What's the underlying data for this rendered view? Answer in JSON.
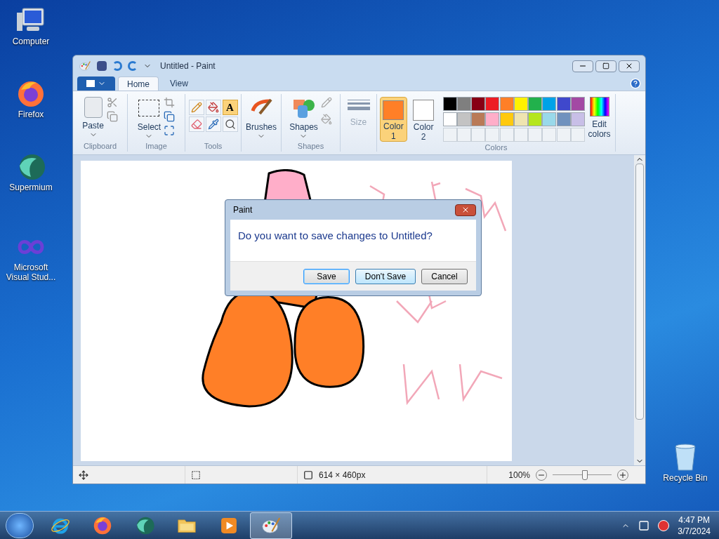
{
  "desktop_icons": [
    {
      "kind": "computer",
      "label": "Computer"
    },
    {
      "kind": "firefox",
      "label": "Firefox"
    },
    {
      "kind": "supermium",
      "label": "Supermium"
    },
    {
      "kind": "vs",
      "label": "Microsoft Visual Stud..."
    },
    {
      "kind": "recycle",
      "label": "Recycle Bin"
    }
  ],
  "window": {
    "title": "Untitled - Paint",
    "tabs": [
      {
        "label": "Home",
        "selected": true
      },
      {
        "label": "View",
        "selected": false
      }
    ],
    "ribbon": {
      "clipboard": {
        "label": "Clipboard",
        "paste": "Paste"
      },
      "image": {
        "label": "Image",
        "select": "Select"
      },
      "tools": {
        "label": "Tools",
        "items": [
          {
            "kind": "pencil",
            "selected": false
          },
          {
            "kind": "fill",
            "selected": false
          },
          {
            "kind": "text",
            "glyph": "A",
            "selected": true
          },
          {
            "kind": "eraser",
            "selected": false
          },
          {
            "kind": "picker",
            "selected": false
          },
          {
            "kind": "magnifier",
            "selected": false
          }
        ]
      },
      "brushes": "Brushes",
      "shapes": {
        "label": "Shapes",
        "button": "Shapes"
      },
      "size": {
        "label": "Size",
        "disabled": true
      },
      "colors": {
        "label": "Colors",
        "edit": "Edit colors",
        "current": [
          {
            "label": "Color 1",
            "color": "#ff7f27",
            "selected": true
          },
          {
            "label": "Color 2",
            "color": "#ffffff",
            "selected": false
          }
        ],
        "palette": [
          {
            "color": "#000000"
          },
          {
            "color": "#7f7f7f"
          },
          {
            "color": "#880015"
          },
          {
            "color": "#ed1c24"
          },
          {
            "color": "#ff7f27"
          },
          {
            "color": "#fff200"
          },
          {
            "color": "#22b14c"
          },
          {
            "color": "#00a2e8"
          },
          {
            "color": "#3f48cc"
          },
          {
            "color": "#a349a4"
          },
          {
            "color": "#ffffff"
          },
          {
            "color": "#c3c3c3"
          },
          {
            "color": "#b97a57"
          },
          {
            "color": "#ffaec9"
          },
          {
            "color": "#ffc90e"
          },
          {
            "color": "#efe4b0"
          },
          {
            "color": "#b5e61d"
          },
          {
            "color": "#99d9ea"
          },
          {
            "color": "#7092be"
          },
          {
            "color": "#c8bfe7"
          }
        ]
      }
    },
    "status_bar": {
      "size": "614 × 460px",
      "zoom": "100%",
      "level": 0.55
    }
  },
  "dialog": {
    "title": "Paint",
    "message": "Do you want to save changes to Untitled?",
    "buttons": [
      {
        "label": "Save",
        "default": true,
        "hovered": false
      },
      {
        "label": "Don't Save",
        "default": false,
        "hovered": true
      },
      {
        "label": "Cancel",
        "default": false,
        "hovered": false
      }
    ]
  },
  "taskbar": {
    "apps": [
      {
        "kind": "ie",
        "active": false
      },
      {
        "kind": "firefox",
        "active": false
      },
      {
        "kind": "supermium",
        "active": false
      },
      {
        "kind": "explorer",
        "active": false
      },
      {
        "kind": "media",
        "active": false
      },
      {
        "kind": "paint",
        "active": true
      }
    ],
    "time": "4:47 PM",
    "date": "3/7/2024"
  }
}
